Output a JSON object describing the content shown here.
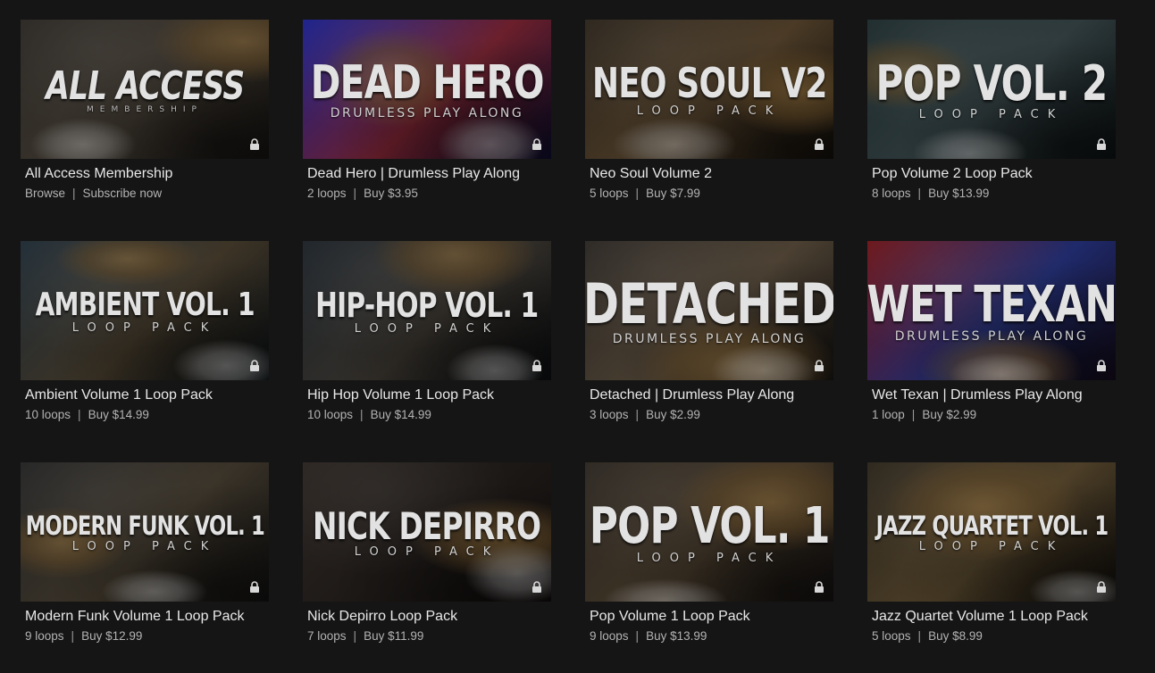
{
  "cards": [
    {
      "art_title": "ALL ACCESS",
      "art_subtitle": "MEMBERSHIP",
      "title": "All Access Membership",
      "meta_left": "Browse",
      "meta_right": "Subscribe now",
      "lock_icon": "lock-icon",
      "theme": [
        "#2a2723",
        "#3a342c",
        "#141210"
      ]
    },
    {
      "art_title": "DEAD HERO",
      "art_subtitle": "DRUMLESS PLAY ALONG",
      "title": "Dead Hero | Drumless Play Along",
      "meta_left": "2 loops",
      "meta_right": "Buy $3.95",
      "lock_icon": "lock-icon",
      "theme": [
        "#1a1f8a",
        "#6b1f2b",
        "#0c0c2a"
      ]
    },
    {
      "art_title": "NEO SOUL V2",
      "art_subtitle": "LOOP PACK",
      "title": "Neo Soul Volume 2",
      "meta_left": "5 loops",
      "meta_right": "Buy $7.99",
      "lock_icon": "lock-icon",
      "theme": [
        "#2b241b",
        "#4a3a26",
        "#100d09"
      ]
    },
    {
      "art_title": "POP VOL. 2",
      "art_subtitle": "LOOP PACK",
      "title": "Pop Volume 2 Loop Pack",
      "meta_left": "8 loops",
      "meta_right": "Buy $13.99",
      "lock_icon": "lock-icon",
      "theme": [
        "#1d2a2c",
        "#2e3a3c",
        "#0b1011"
      ]
    },
    {
      "art_title": "AMBIENT VOL. 1",
      "art_subtitle": "LOOP PACK",
      "title": "Ambient Volume 1 Loop Pack",
      "meta_left": "10 loops",
      "meta_right": "Buy $14.99",
      "lock_icon": "lock-icon",
      "theme": [
        "#1e2a33",
        "#3d3426",
        "#0c1216"
      ]
    },
    {
      "art_title": "HIP-HOP VOL. 1",
      "art_subtitle": "LOOP PACK",
      "title": "Hip Hop Volume 1 Loop Pack",
      "meta_left": "10 loops",
      "meta_right": "Buy $14.99",
      "lock_icon": "lock-icon",
      "theme": [
        "#1c2228",
        "#34302a",
        "#0b0d10"
      ]
    },
    {
      "art_title": "DETACHED",
      "art_subtitle": "DRUMLESS PLAY ALONG",
      "title": "Detached | Drumless Play Along",
      "meta_left": "3 loops",
      "meta_right": "Buy $2.99",
      "lock_icon": "lock-icon",
      "theme": [
        "#2a2622",
        "#4b4032",
        "#141210"
      ]
    },
    {
      "art_title": "WET TEXAN",
      "art_subtitle": "DRUMLESS PLAY ALONG",
      "title": "Wet Texan | Drumless Play Along",
      "meta_left": "1 loop",
      "meta_right": "Buy $2.99",
      "lock_icon": "lock-icon",
      "theme": [
        "#6b1418",
        "#1f2a6b",
        "#120a18"
      ]
    },
    {
      "art_title": "MODERN FUNK VOL. 1",
      "art_subtitle": "LOOP PACK",
      "title": "Modern Funk Volume 1 Loop Pack",
      "meta_left": "9 loops",
      "meta_right": "Buy $12.99",
      "lock_icon": "lock-icon",
      "theme": [
        "#232323",
        "#3a3328",
        "#101010"
      ]
    },
    {
      "art_title": "NICK DEPIRRO",
      "art_subtitle": "LOOP PACK",
      "title": "Nick Depirro Loop Pack",
      "meta_left": "7 loops",
      "meta_right": "Buy $11.99",
      "lock_icon": "lock-icon",
      "theme": [
        "#2a2420",
        "#1c1816",
        "#0f0c0b"
      ]
    },
    {
      "art_title": "POP VOL. 1",
      "art_subtitle": "LOOP PACK",
      "title": "Pop Volume 1 Loop Pack",
      "meta_left": "9 loops",
      "meta_right": "Buy $13.99",
      "lock_icon": "lock-icon",
      "theme": [
        "#2b2620",
        "#3f3426",
        "#121010"
      ]
    },
    {
      "art_title": "JAZZ QUARTET VOL. 1",
      "art_subtitle": "LOOP PACK",
      "title": "Jazz Quartet Volume 1 Loop Pack",
      "meta_left": "5 loops",
      "meta_right": "Buy $8.99",
      "lock_icon": "lock-icon",
      "theme": [
        "#2a241a",
        "#4d3f28",
        "#0f0d0a"
      ]
    }
  ]
}
